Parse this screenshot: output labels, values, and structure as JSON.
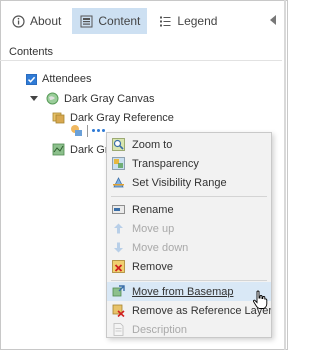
{
  "tabs": [
    {
      "label": "About",
      "icon": "info-icon",
      "active": false
    },
    {
      "label": "Content",
      "icon": "content-icon",
      "active": true
    },
    {
      "label": "Legend",
      "icon": "legend-icon",
      "active": false
    }
  ],
  "section_title": "Contents",
  "tree": {
    "attendees": "Attendees",
    "canvas": "Dark Gray Canvas",
    "reference": "Dark Gray Reference",
    "base_truncated": "Dark Gr"
  },
  "context_menu": {
    "items": [
      {
        "label": "Zoom to",
        "icon": "zoom-to-icon",
        "enabled": true
      },
      {
        "label": "Transparency",
        "icon": "transparency-icon",
        "enabled": true
      },
      {
        "label": "Set Visibility Range",
        "icon": "visibility-range-icon",
        "enabled": true
      },
      {
        "label": "Rename",
        "icon": "rename-icon",
        "enabled": true
      },
      {
        "label": "Move up",
        "icon": "arrow-up-icon",
        "enabled": false
      },
      {
        "label": "Move down",
        "icon": "arrow-down-icon",
        "enabled": false
      },
      {
        "label": "Remove",
        "icon": "remove-icon",
        "enabled": true
      },
      {
        "label": "Move from Basemap",
        "icon": "move-from-basemap-icon",
        "enabled": true,
        "hovered": true
      },
      {
        "label": "Remove as Reference Layer",
        "icon": "remove-reference-icon",
        "enabled": true
      },
      {
        "label": "Description",
        "icon": "description-icon",
        "enabled": false
      }
    ]
  },
  "colors": {
    "accent": "#2f7bd6",
    "active_tab": "#cde0f2",
    "menu_bg": "#f2f2f2",
    "hover": "#d9e8f6"
  }
}
